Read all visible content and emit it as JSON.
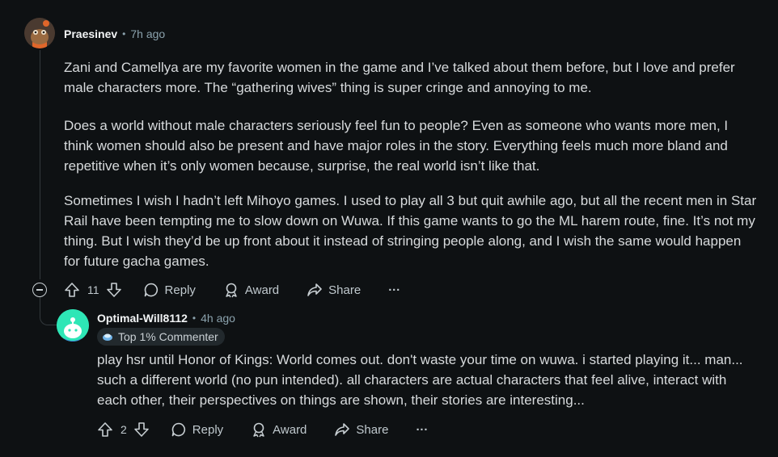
{
  "comment1": {
    "author": "Praesinev",
    "time": "7h ago",
    "paragraphs": [
      "Zani and Camellya are my favorite women in the game and I’ve talked about them before, but I love and prefer male characters more. The “gathering wives” thing is super cringe and annoying to me.",
      "Does a world without male characters seriously feel fun to people? Even as someone who wants more men, I think women should also be present and have major roles in the story. Everything feels much more bland and repetitive when it’s only women because, surprise, the real world isn’t like that.",
      "Sometimes I wish I hadn’t left Mihoyo games. I used to play all 3 but quit awhile ago, but all the recent men in Star Rail have been tempting me to slow down on Wuwa. If this game wants to go the ML harem route, fine. It’s not my thing. But I wish they’d be up front about it instead of stringing people along, and I wish the same would happen for future gacha games."
    ],
    "votes": "11",
    "reply_label": "Reply",
    "award_label": "Award",
    "share_label": "Share",
    "more_label": "···"
  },
  "comment2": {
    "author": "Optimal-Will8112",
    "time": "4h ago",
    "flair": "Top 1% Commenter",
    "paragraphs": [
      "play hsr until Honor of Kings: World comes out. don't waste your time on wuwa. i started playing it... man... such a different world (no pun intended). all characters are actual characters that feel alive, interact with each other, their perspectives on things are shown, their stories are interesting..."
    ],
    "votes": "2",
    "reply_label": "Reply",
    "award_label": "Award",
    "share_label": "Share",
    "more_label": "···"
  },
  "separator": "•",
  "colors": {
    "background": "#0e1113",
    "text": "#d7dadc",
    "meta": "#8ba2ad",
    "avatar2": "#2ee6b6"
  },
  "icons": [
    "upvote-icon",
    "downvote-icon",
    "reply-icon",
    "award-icon",
    "share-icon",
    "more-icon",
    "collapse-icon",
    "flair-icon"
  ]
}
